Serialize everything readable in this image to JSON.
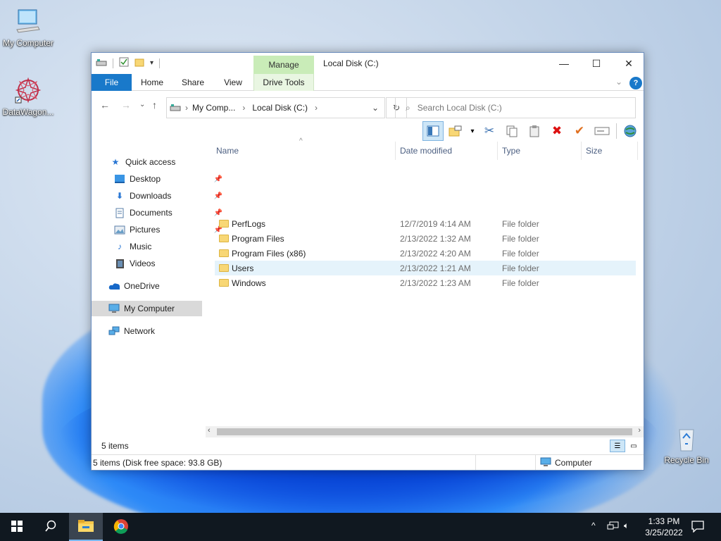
{
  "desktop": {
    "icons": [
      {
        "label": "My Computer"
      },
      {
        "label": "DataWagon..."
      },
      {
        "label": "Recycle Bin"
      }
    ]
  },
  "window": {
    "title": "Local Disk (C:)",
    "contextual_group": "Manage",
    "tabs": {
      "file": "File",
      "home": "Home",
      "share": "Share",
      "view": "View",
      "drive_tools": "Drive Tools"
    },
    "address": {
      "segments": [
        "My Comp...",
        "Local Disk (C:)"
      ]
    },
    "search": {
      "placeholder": "Search Local Disk (C:)"
    },
    "nav": {
      "quick_access": "Quick access",
      "desktop": "Desktop",
      "downloads": "Downloads",
      "documents": "Documents",
      "pictures": "Pictures",
      "music": "Music",
      "videos": "Videos",
      "onedrive": "OneDrive",
      "my_computer": "My Computer",
      "network": "Network"
    },
    "columns": {
      "name": "Name",
      "date": "Date modified",
      "type": "Type",
      "size": "Size"
    },
    "files": [
      {
        "name": "PerfLogs",
        "date": "12/7/2019 4:14 AM",
        "type": "File folder"
      },
      {
        "name": "Program Files",
        "date": "2/13/2022 1:32 AM",
        "type": "File folder"
      },
      {
        "name": "Program Files (x86)",
        "date": "2/13/2022 4:20 AM",
        "type": "File folder"
      },
      {
        "name": "Users",
        "date": "2/13/2022 1:21 AM",
        "type": "File folder"
      },
      {
        "name": "Windows",
        "date": "2/13/2022 1:23 AM",
        "type": "File folder"
      }
    ],
    "item_count": "5 items",
    "status_left": "5 items (Disk free space: 93.8 GB)",
    "status_right": "Computer"
  },
  "taskbar": {
    "time": "1:33 PM",
    "date": "3/25/2022"
  },
  "colors": {
    "accent": "#1979ca",
    "manage_tab": "#c9ecb8",
    "selection": "#e5f3fb",
    "taskbar": "#101820"
  }
}
